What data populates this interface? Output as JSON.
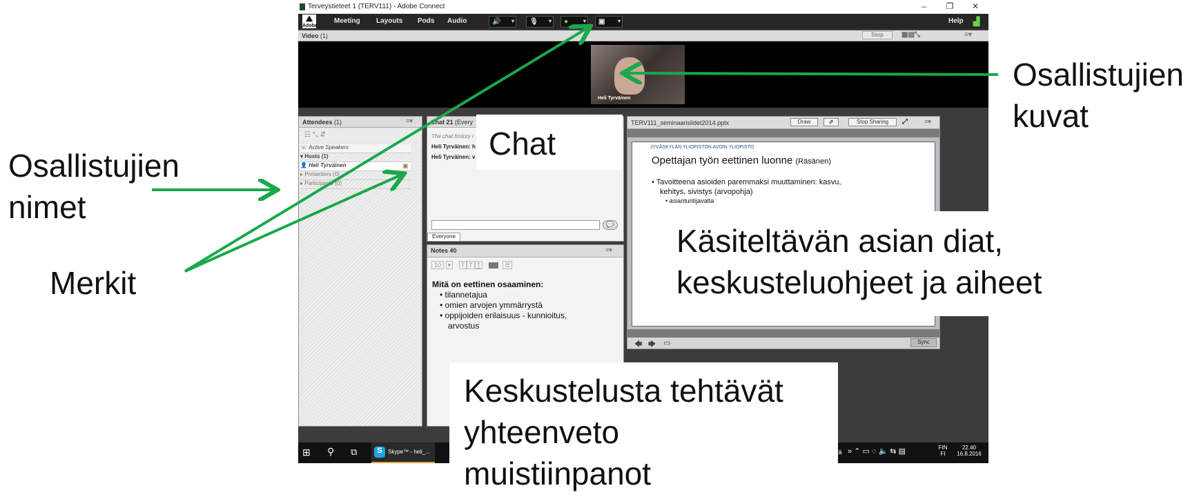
{
  "window": {
    "title": "Terveystieteet 1 (TERV111) - Adobe Connect",
    "minimize_label": "–",
    "restore_label": "❐",
    "close_label": "✕"
  },
  "menubar": {
    "logo": "Adobe",
    "items": [
      "Meeting",
      "Layouts",
      "Pods",
      "Audio"
    ],
    "help": "Help"
  },
  "video_pod": {
    "title": "Video",
    "count": "(1)",
    "stop_label": "Stop",
    "participant_name": "Heli Tyrväinen"
  },
  "attendees_pod": {
    "title": "Attendees",
    "count": "(1)",
    "active_speakers": "Active Speakers",
    "hosts": "Hosts (1)",
    "host_name": "Heli Tyrväinen",
    "presenters": "Presenters (0)",
    "participants": "Participants (0)"
  },
  "chat_pod": {
    "title": "Chat 21",
    "subtitle": "(Every",
    "history_note": "The chat history i",
    "messages": [
      "Heli Tyrväinen: h",
      "Heli Tyrväinen: v"
    ],
    "tab_everyone": "Everyone"
  },
  "notes_pod": {
    "title": "Notes 40",
    "font_size": "10",
    "heading": "Mitä on eettinen osaaminen:",
    "bullets": [
      "tilannetajua",
      "omien arvojen ymmärrystä",
      "oppijoiden erilaisuus - kunnioitus,",
      "arvostus"
    ]
  },
  "share_pod": {
    "filename": "TERV111_seminaarislidet2014.pptx",
    "draw_label": "Draw",
    "stop_sharing_label": "Stop Sharing",
    "sync_label": "Sync",
    "slide": {
      "university": "JYVÄSKYLÄN YLIOPISTON AVOIN YLIOPISTO",
      "title": "Opettajan työn eettinen luonne",
      "title_suffix": "(Räsänen)",
      "bullet1": "Tavoitteena asioiden paremmaksi muuttaminen: kasvu,",
      "bullet1b": "kehitys, sivistys  (arvopohja)",
      "sub1": "asiantuntijavalta"
    }
  },
  "taskbar": {
    "skype_label": "Skype™ - heli_...",
    "lang_top": "FIN",
    "lang_bottom": "FI",
    "time": "22.40",
    "date": "16.8.2016",
    "truncated": "tä"
  },
  "callouts": {
    "names_line1": "Osallistujien",
    "names_line2": "nimet",
    "marks": "Merkit",
    "chat": "Chat",
    "pictures_line1": "Osallistujien",
    "pictures_line2": "kuvat",
    "slides_line1": "Käsiteltävän asian diat,",
    "slides_line2": "keskusteluohjeet ja aiheet",
    "summary_line1": "Keskustelusta tehtävät",
    "summary_line2": "yhteenveto",
    "summary_line3": "muistiinpanot"
  },
  "colors": {
    "arrow": "#1aa84a",
    "accent_green": "#6ad34a",
    "taskbar": "#111111"
  }
}
